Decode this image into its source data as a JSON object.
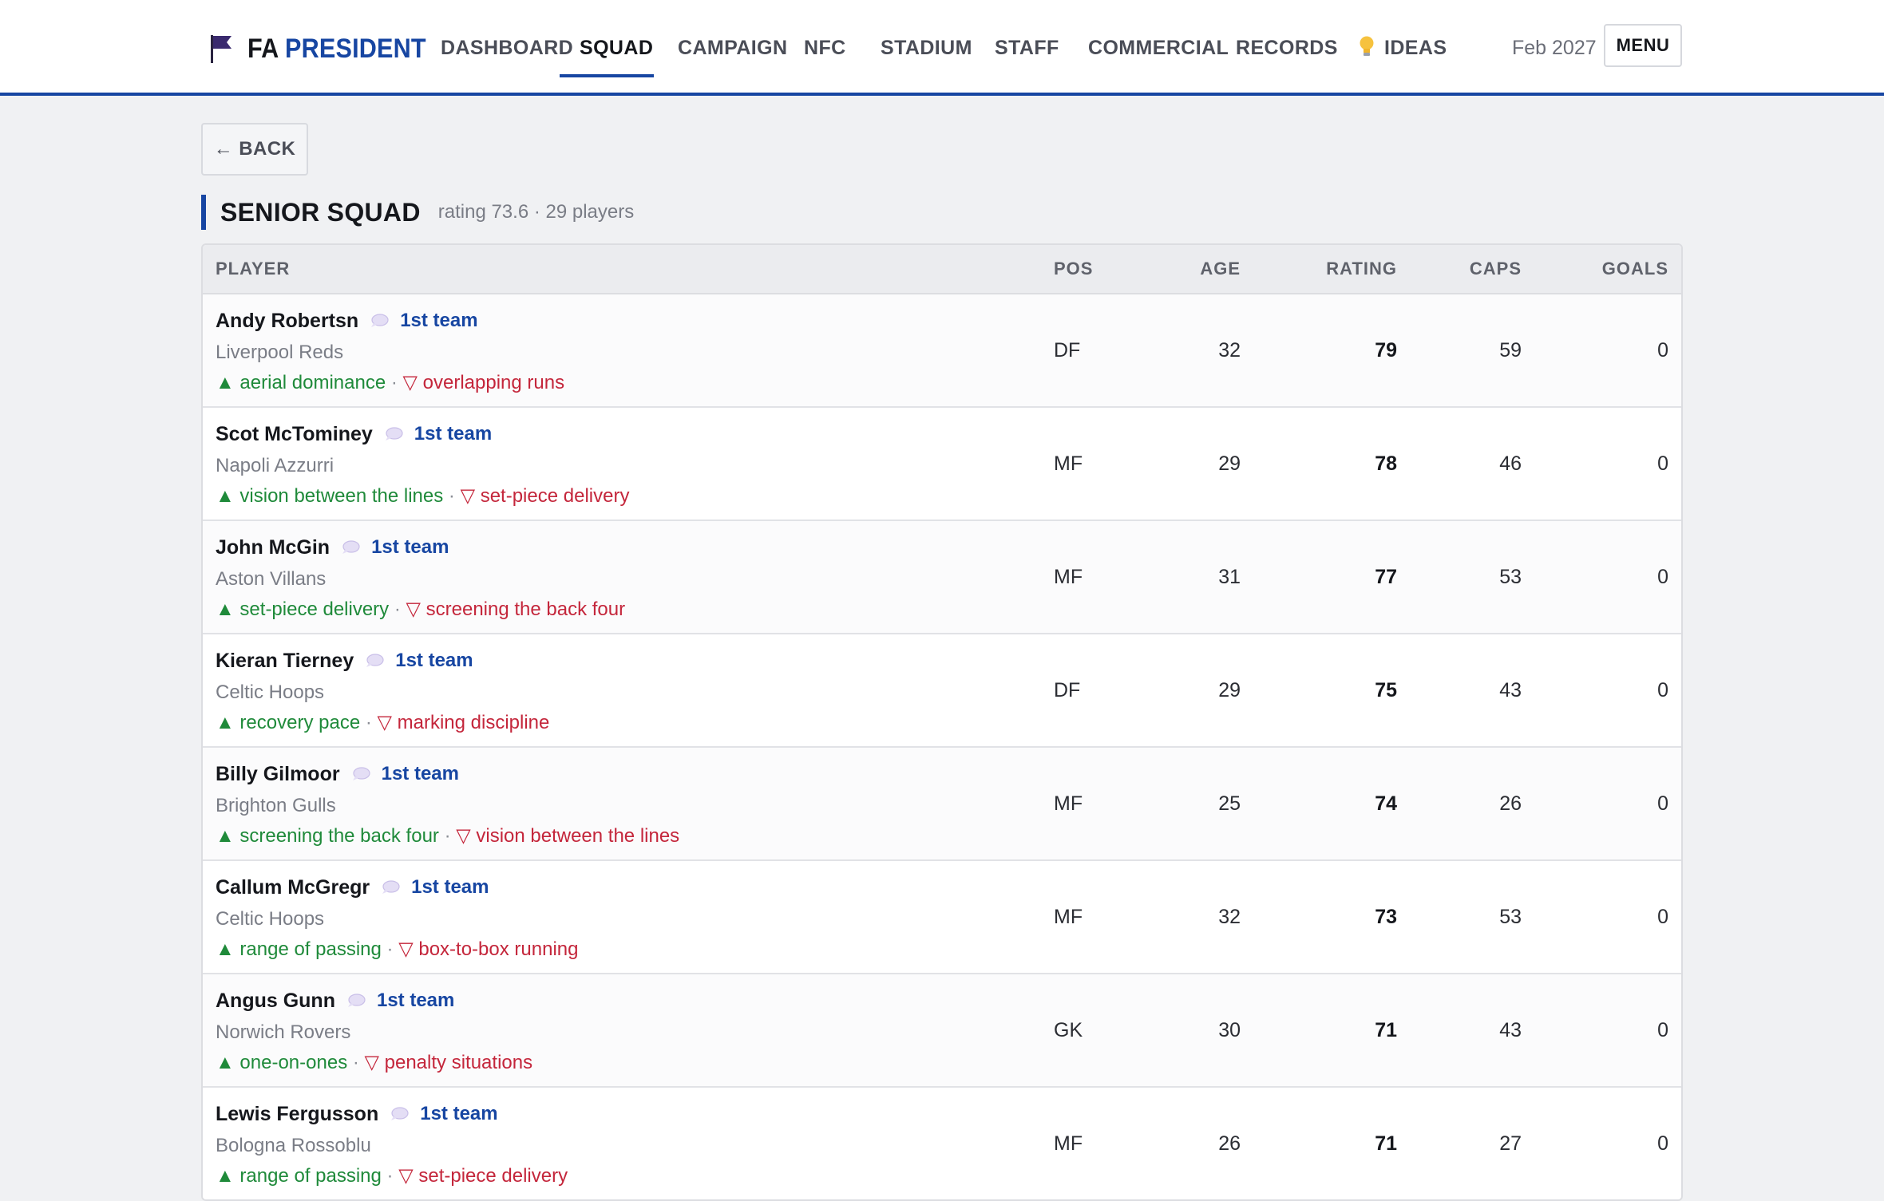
{
  "header": {
    "brand_prefix": "FA",
    "brand_main": "PRESIDENT",
    "nav": [
      {
        "label": "DASHBOARD",
        "active": false
      },
      {
        "label": "SQUAD",
        "active": true
      },
      {
        "label": "CAMPAIGN",
        "active": false
      },
      {
        "label": "NFC",
        "active": false
      },
      {
        "label": "STADIUM",
        "active": false
      },
      {
        "label": "STAFF",
        "active": false
      },
      {
        "label": "COMMERCIAL",
        "active": false
      },
      {
        "label": "RECORDS",
        "active": false
      },
      {
        "label": "IDEAS",
        "active": false,
        "icon": "lightbulb-icon"
      }
    ],
    "date": "Feb 2027",
    "menu_label": "MENU"
  },
  "back_label": "← BACK",
  "section": {
    "title": "SENIOR SQUAD",
    "meta": "rating 73.6 · 29 players"
  },
  "table": {
    "columns": [
      "PLAYER",
      "POS",
      "AGE",
      "RATING",
      "CAPS",
      "GOALS"
    ],
    "rows": [
      {
        "name": "Andy Robertsn",
        "tag": "1st team",
        "club": "Liverpool Reds",
        "strength": "aerial dominance",
        "weakness": "overlapping runs",
        "pos": "DF",
        "age": "32",
        "rating": "79",
        "caps": "59",
        "goals": "0"
      },
      {
        "name": "Scot McTominey",
        "tag": "1st team",
        "club": "Napoli Azzurri",
        "strength": "vision between the lines",
        "weakness": "set-piece delivery",
        "pos": "MF",
        "age": "29",
        "rating": "78",
        "caps": "46",
        "goals": "0"
      },
      {
        "name": "John McGin",
        "tag": "1st team",
        "club": "Aston Villans",
        "strength": "set-piece delivery",
        "weakness": "screening the back four",
        "pos": "MF",
        "age": "31",
        "rating": "77",
        "caps": "53",
        "goals": "0"
      },
      {
        "name": "Kieran Tierney",
        "tag": "1st team",
        "club": "Celtic Hoops",
        "strength": "recovery pace",
        "weakness": "marking discipline",
        "pos": "DF",
        "age": "29",
        "rating": "75",
        "caps": "43",
        "goals": "0"
      },
      {
        "name": "Billy Gilmoor",
        "tag": "1st team",
        "club": "Brighton Gulls",
        "strength": "screening the back four",
        "weakness": "vision between the lines",
        "pos": "MF",
        "age": "25",
        "rating": "74",
        "caps": "26",
        "goals": "0"
      },
      {
        "name": "Callum McGregr",
        "tag": "1st team",
        "club": "Celtic Hoops",
        "strength": "range of passing",
        "weakness": "box-to-box running",
        "pos": "MF",
        "age": "32",
        "rating": "73",
        "caps": "53",
        "goals": "0"
      },
      {
        "name": "Angus Gunn",
        "tag": "1st team",
        "club": "Norwich Rovers",
        "strength": "one-on-ones",
        "weakness": "penalty situations",
        "pos": "GK",
        "age": "30",
        "rating": "71",
        "caps": "43",
        "goals": "0"
      },
      {
        "name": "Lewis Fergusson",
        "tag": "1st team",
        "club": "Bologna Rossoblu",
        "strength": "range of passing",
        "weakness": "set-piece delivery",
        "pos": "MF",
        "age": "26",
        "rating": "71",
        "caps": "27",
        "goals": "0"
      }
    ]
  },
  "colors": {
    "accent": "#1746a2",
    "strength": "#1f8a3a",
    "weakness": "#c4263b"
  }
}
